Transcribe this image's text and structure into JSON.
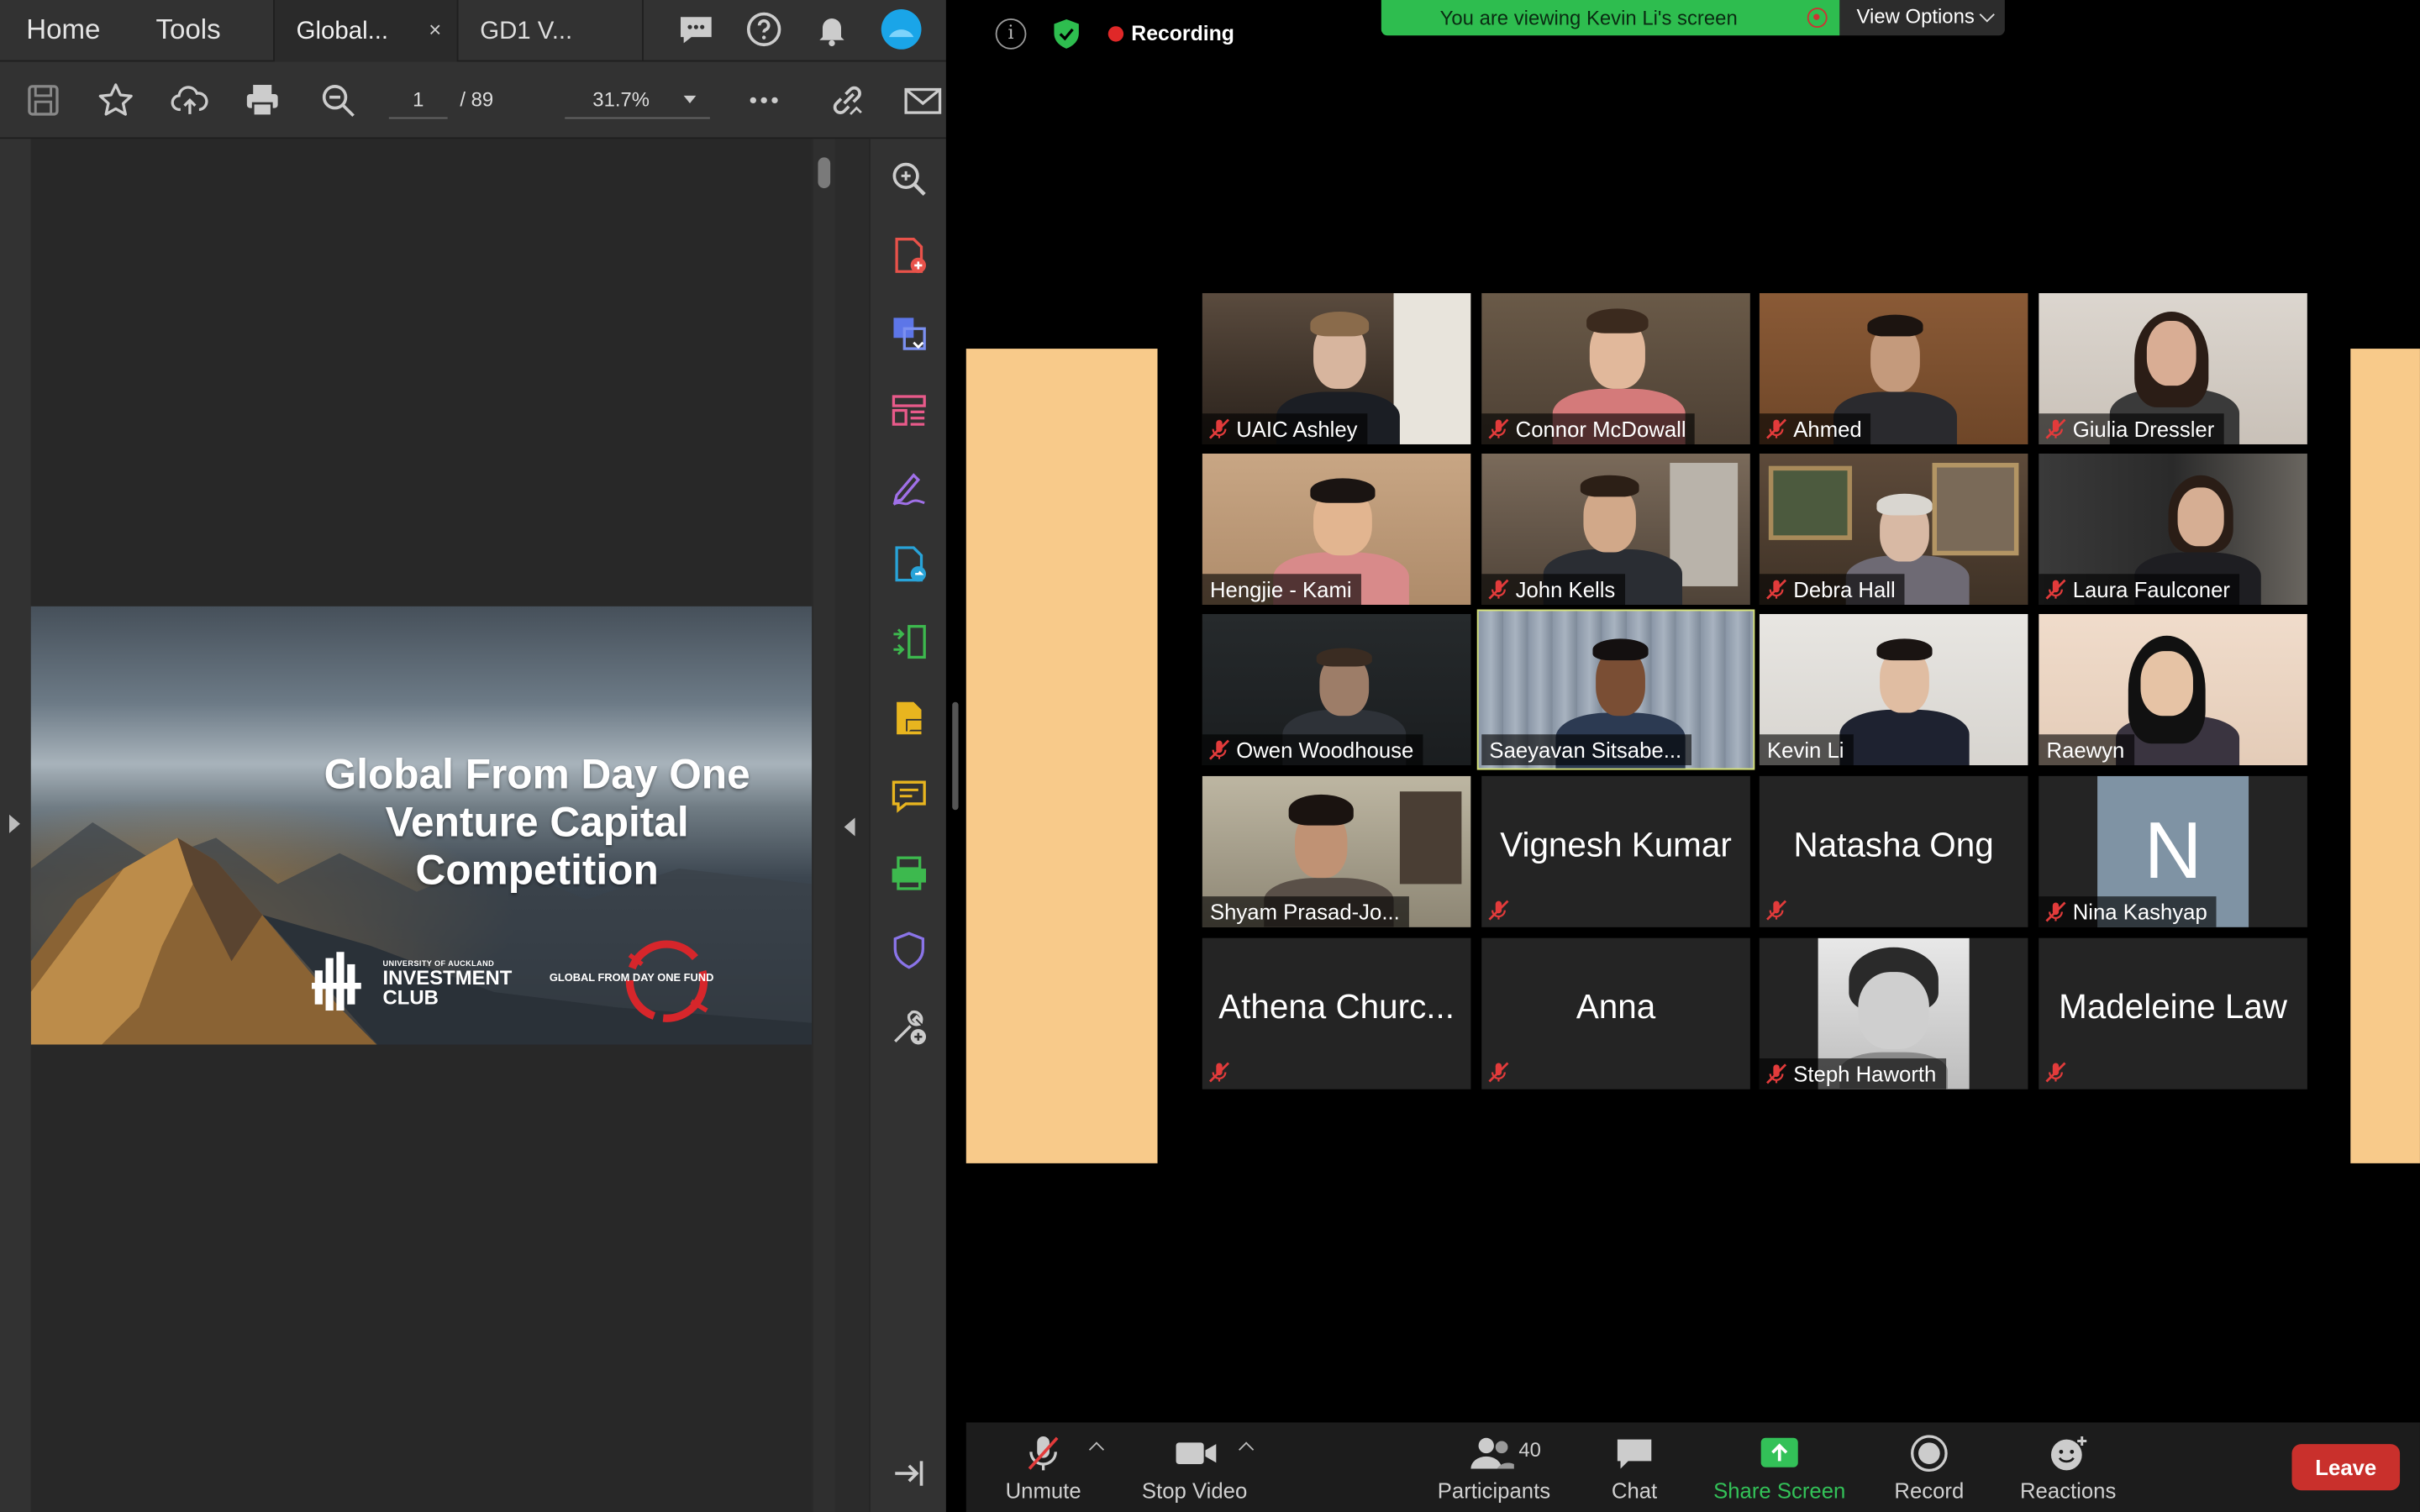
{
  "acrobat": {
    "nav": {
      "home": "Home",
      "tools": "Tools"
    },
    "tabs": [
      {
        "label": "Global...",
        "close": "×"
      },
      {
        "label": "GD1 V..."
      }
    ],
    "toolbar": {
      "page_current": "1",
      "page_total": "/ 89",
      "zoom": "31.7%"
    },
    "slide": {
      "title_lines": [
        "Global From Day One",
        "Venture Capital",
        "Competition"
      ],
      "uaic_small": "UNIVERSITY OF AUCKLAND",
      "uaic_line1": "INVESTMENT",
      "uaic_line2": "CLUB",
      "fund_name": "GLOBAL FROM DAY ONE FUND"
    }
  },
  "zoom": {
    "recording_label": "Recording",
    "viewing_banner": "You are viewing Kevin Li's screen",
    "view_options": "View Options",
    "participants_tiles": [
      {
        "name": "UAIC Ashley",
        "muted": true
      },
      {
        "name": "Connor McDowall",
        "muted": true
      },
      {
        "name": "Ahmed",
        "muted": true
      },
      {
        "name": "Giulia Dressler",
        "muted": true
      },
      {
        "name": "Hengjie - Kami",
        "muted": false
      },
      {
        "name": "John Kells",
        "muted": true
      },
      {
        "name": "Debra Hall",
        "muted": true
      },
      {
        "name": "Laura Faulconer",
        "muted": true
      },
      {
        "name": "Owen Woodhouse",
        "muted": true
      },
      {
        "name": "Saeyavan Sitsabe...",
        "muted": false,
        "active_speaker": true
      },
      {
        "name": "Kevin Li",
        "muted": false
      },
      {
        "name": "Raewyn",
        "muted": false
      },
      {
        "name": "Shyam Prasad-Jo...",
        "muted": false
      },
      {
        "name": "Vignesh Kumar",
        "muted": true
      },
      {
        "name": "Natasha Ong",
        "muted": true
      },
      {
        "name": "Nina Kashyap",
        "muted": true,
        "avatar_letter": "N"
      },
      {
        "name": "Athena Churc...",
        "muted": true
      },
      {
        "name": "Anna",
        "muted": true
      },
      {
        "name": "Steph Haworth",
        "muted": true
      },
      {
        "name": "Madeleine Law",
        "muted": true
      }
    ],
    "controls": {
      "unmute": "Unmute",
      "stop_video": "Stop Video",
      "participants": "Participants",
      "participant_count": "40",
      "chat": "Chat",
      "share_screen": "Share Screen",
      "record": "Record",
      "reactions": "Reactions",
      "leave": "Leave"
    },
    "colors": {
      "banner_green": "#2ebd4f",
      "active_speaker": "#d7e37a",
      "leave_red": "#c9302c",
      "side_panel": "#f8ca8a"
    }
  }
}
